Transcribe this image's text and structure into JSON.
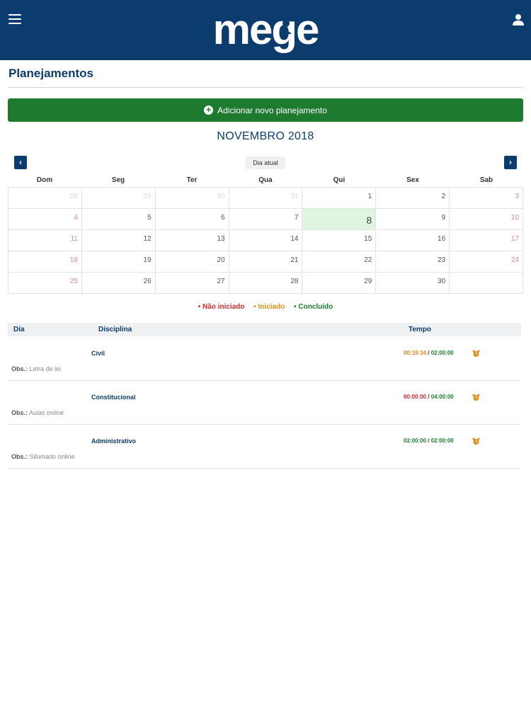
{
  "header": {
    "logo_text": "mege",
    "colors": {
      "bar": "#0c3c6e",
      "accent": "#1e7a2e"
    },
    "icons": {
      "menu": "hamburger-menu-icon",
      "user": "user-group-icon"
    }
  },
  "page": {
    "title": "Planejamentos"
  },
  "add_button": {
    "label": "Adicionar novo planejamento",
    "icon": "plus-circle-icon"
  },
  "calendar": {
    "month_label": "NOVEMBRO 2018",
    "today_label": "Dia atual",
    "weekdays": [
      "Dom",
      "Seg",
      "Ter",
      "Qua",
      "Qui",
      "Sex",
      "Sab"
    ],
    "weeks": [
      [
        "28",
        "29",
        "30",
        "31",
        "1",
        "2",
        "3"
      ],
      [
        "4",
        "5",
        "6",
        "7",
        "8",
        "9",
        "10"
      ],
      [
        "11",
        "12",
        "13",
        "14",
        "15",
        "16",
        "17"
      ],
      [
        "18",
        "19",
        "20",
        "21",
        "22",
        "23",
        "24"
      ],
      [
        "25",
        "26",
        "27",
        "28",
        "29",
        "30",
        ""
      ]
    ],
    "selected_day": "8"
  },
  "legend": {
    "nao_iniciado": "• Não iniciado",
    "iniciado": "• Iniciado",
    "concluido": "• Concluído"
  },
  "table": {
    "headers": {
      "dia": "Dia",
      "disciplina": "Disciplina",
      "tempo": "Tempo"
    },
    "obs_label": "Obs.:",
    "rows": [
      {
        "disciplina": "Civil",
        "elapsed": "00:19:34",
        "separator": " / ",
        "total": "02:00:00",
        "obs": "Letra de lei",
        "status": "iniciado"
      },
      {
        "disciplina": "Constitucional",
        "elapsed": "00:00:00",
        "separator": " / ",
        "total": "04:00:00",
        "obs": "Aulas online",
        "status": "nao_iniciado"
      },
      {
        "disciplina": "Administrativo",
        "elapsed": "02:00:00",
        "separator": " / ",
        "total": "02:00:00",
        "obs": "Silumado online",
        "status": "concluido"
      }
    ]
  }
}
